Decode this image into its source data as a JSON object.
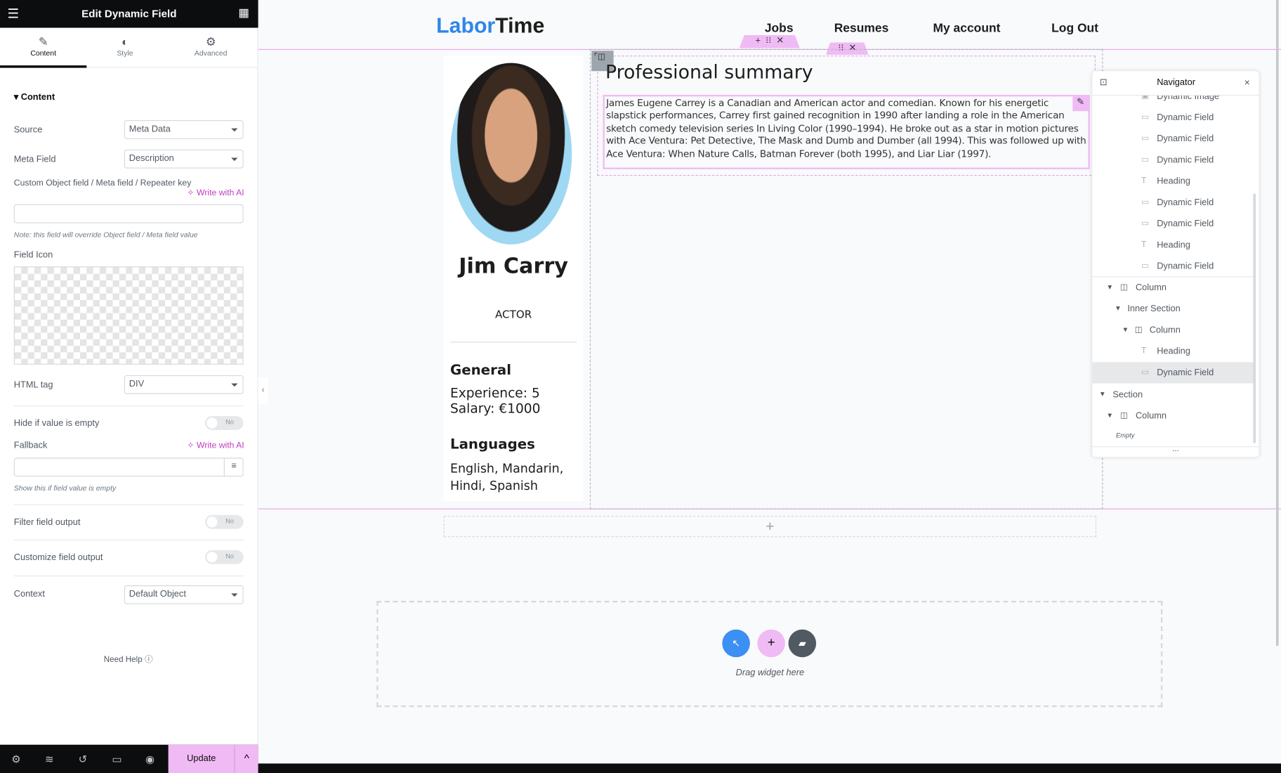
{
  "panel": {
    "title": "Edit Dynamic Field",
    "tabs": [
      {
        "label": "Content",
        "icon": "pencil-icon"
      },
      {
        "label": "Style",
        "icon": "half-circle-icon"
      },
      {
        "label": "Advanced",
        "icon": "gear-icon"
      }
    ],
    "section": "Content",
    "source_label": "Source",
    "source_value": "Meta Data",
    "meta_label": "Meta Field",
    "meta_value": "Description",
    "custom_label": "Custom Object field / Meta field / Repeater key",
    "write_ai": "Write with AI",
    "custom_value": "",
    "custom_note": "Note: this field will override Object field / Meta field value",
    "icon_label": "Field Icon",
    "html_tag_label": "HTML tag",
    "html_tag_value": "DIV",
    "hide_empty_label": "Hide if value is empty",
    "toggle_no": "No",
    "fallback_label": "Fallback",
    "fallback_value": "",
    "fallback_note": "Show this if field value is empty",
    "filter_label": "Filter field output",
    "customize_label": "Customize field output",
    "context_label": "Context",
    "context_value": "Default Object",
    "help": "Need Help",
    "update": "Update"
  },
  "site": {
    "logo_a": "Labor",
    "logo_b": "Time",
    "logo_color": "#2f86e8",
    "nav": [
      "Jobs",
      "Resumes",
      "My account",
      "Log Out"
    ]
  },
  "profile": {
    "name": "Jim Carry",
    "role": "ACTOR",
    "general": "General",
    "experience": "Experience: 5",
    "salary": "Salary: €1000",
    "languages": "Languages",
    "lang_list": "English, Mandarin, Hindi, Spanish"
  },
  "summary": {
    "title": "Professional summary",
    "text": "James Eugene Carrey is a Canadian and American actor and comedian. Known for his energetic slapstick performances, Carrey first gained recognition in 1990 after landing a role in the American sketch comedy television series In Living Color (1990–1994). He broke out as a star in motion pictures with Ace Ventura: Pet Detective, The Mask and Dumb and Dumber (all 1994). This was followed up with Ace Ventura: When Nature Calls, Batman Forever (both 1995), and Liar Liar (1997)."
  },
  "navigator": {
    "title": "Navigator",
    "items": [
      {
        "label": "Dynamic Image",
        "icon": "image-icon"
      },
      {
        "label": "Dynamic Field",
        "icon": "dynamic-field-icon"
      },
      {
        "label": "Dynamic Field",
        "icon": "dynamic-field-icon"
      },
      {
        "label": "Dynamic Field",
        "icon": "dynamic-field-icon"
      },
      {
        "label": "Heading",
        "icon": "heading-icon"
      },
      {
        "label": "Dynamic Field",
        "icon": "dynamic-field-icon"
      },
      {
        "label": "Dynamic Field",
        "icon": "dynamic-field-icon"
      },
      {
        "label": "Heading",
        "icon": "heading-icon"
      },
      {
        "label": "Dynamic Field",
        "icon": "dynamic-field-icon"
      },
      {
        "label": "Column",
        "icon": "column-icon"
      },
      {
        "label": "Inner Section",
        "icon": ""
      },
      {
        "label": "Column",
        "icon": "column-icon"
      },
      {
        "label": "Heading",
        "icon": "heading-icon"
      },
      {
        "label": "Dynamic Field",
        "icon": "dynamic-field-icon"
      },
      {
        "label": "Section",
        "icon": ""
      },
      {
        "label": "Column",
        "icon": "column-icon"
      },
      {
        "label": "Empty",
        "icon": ""
      }
    ],
    "more": "..."
  },
  "dropzone": {
    "text": "Drag widget here"
  }
}
